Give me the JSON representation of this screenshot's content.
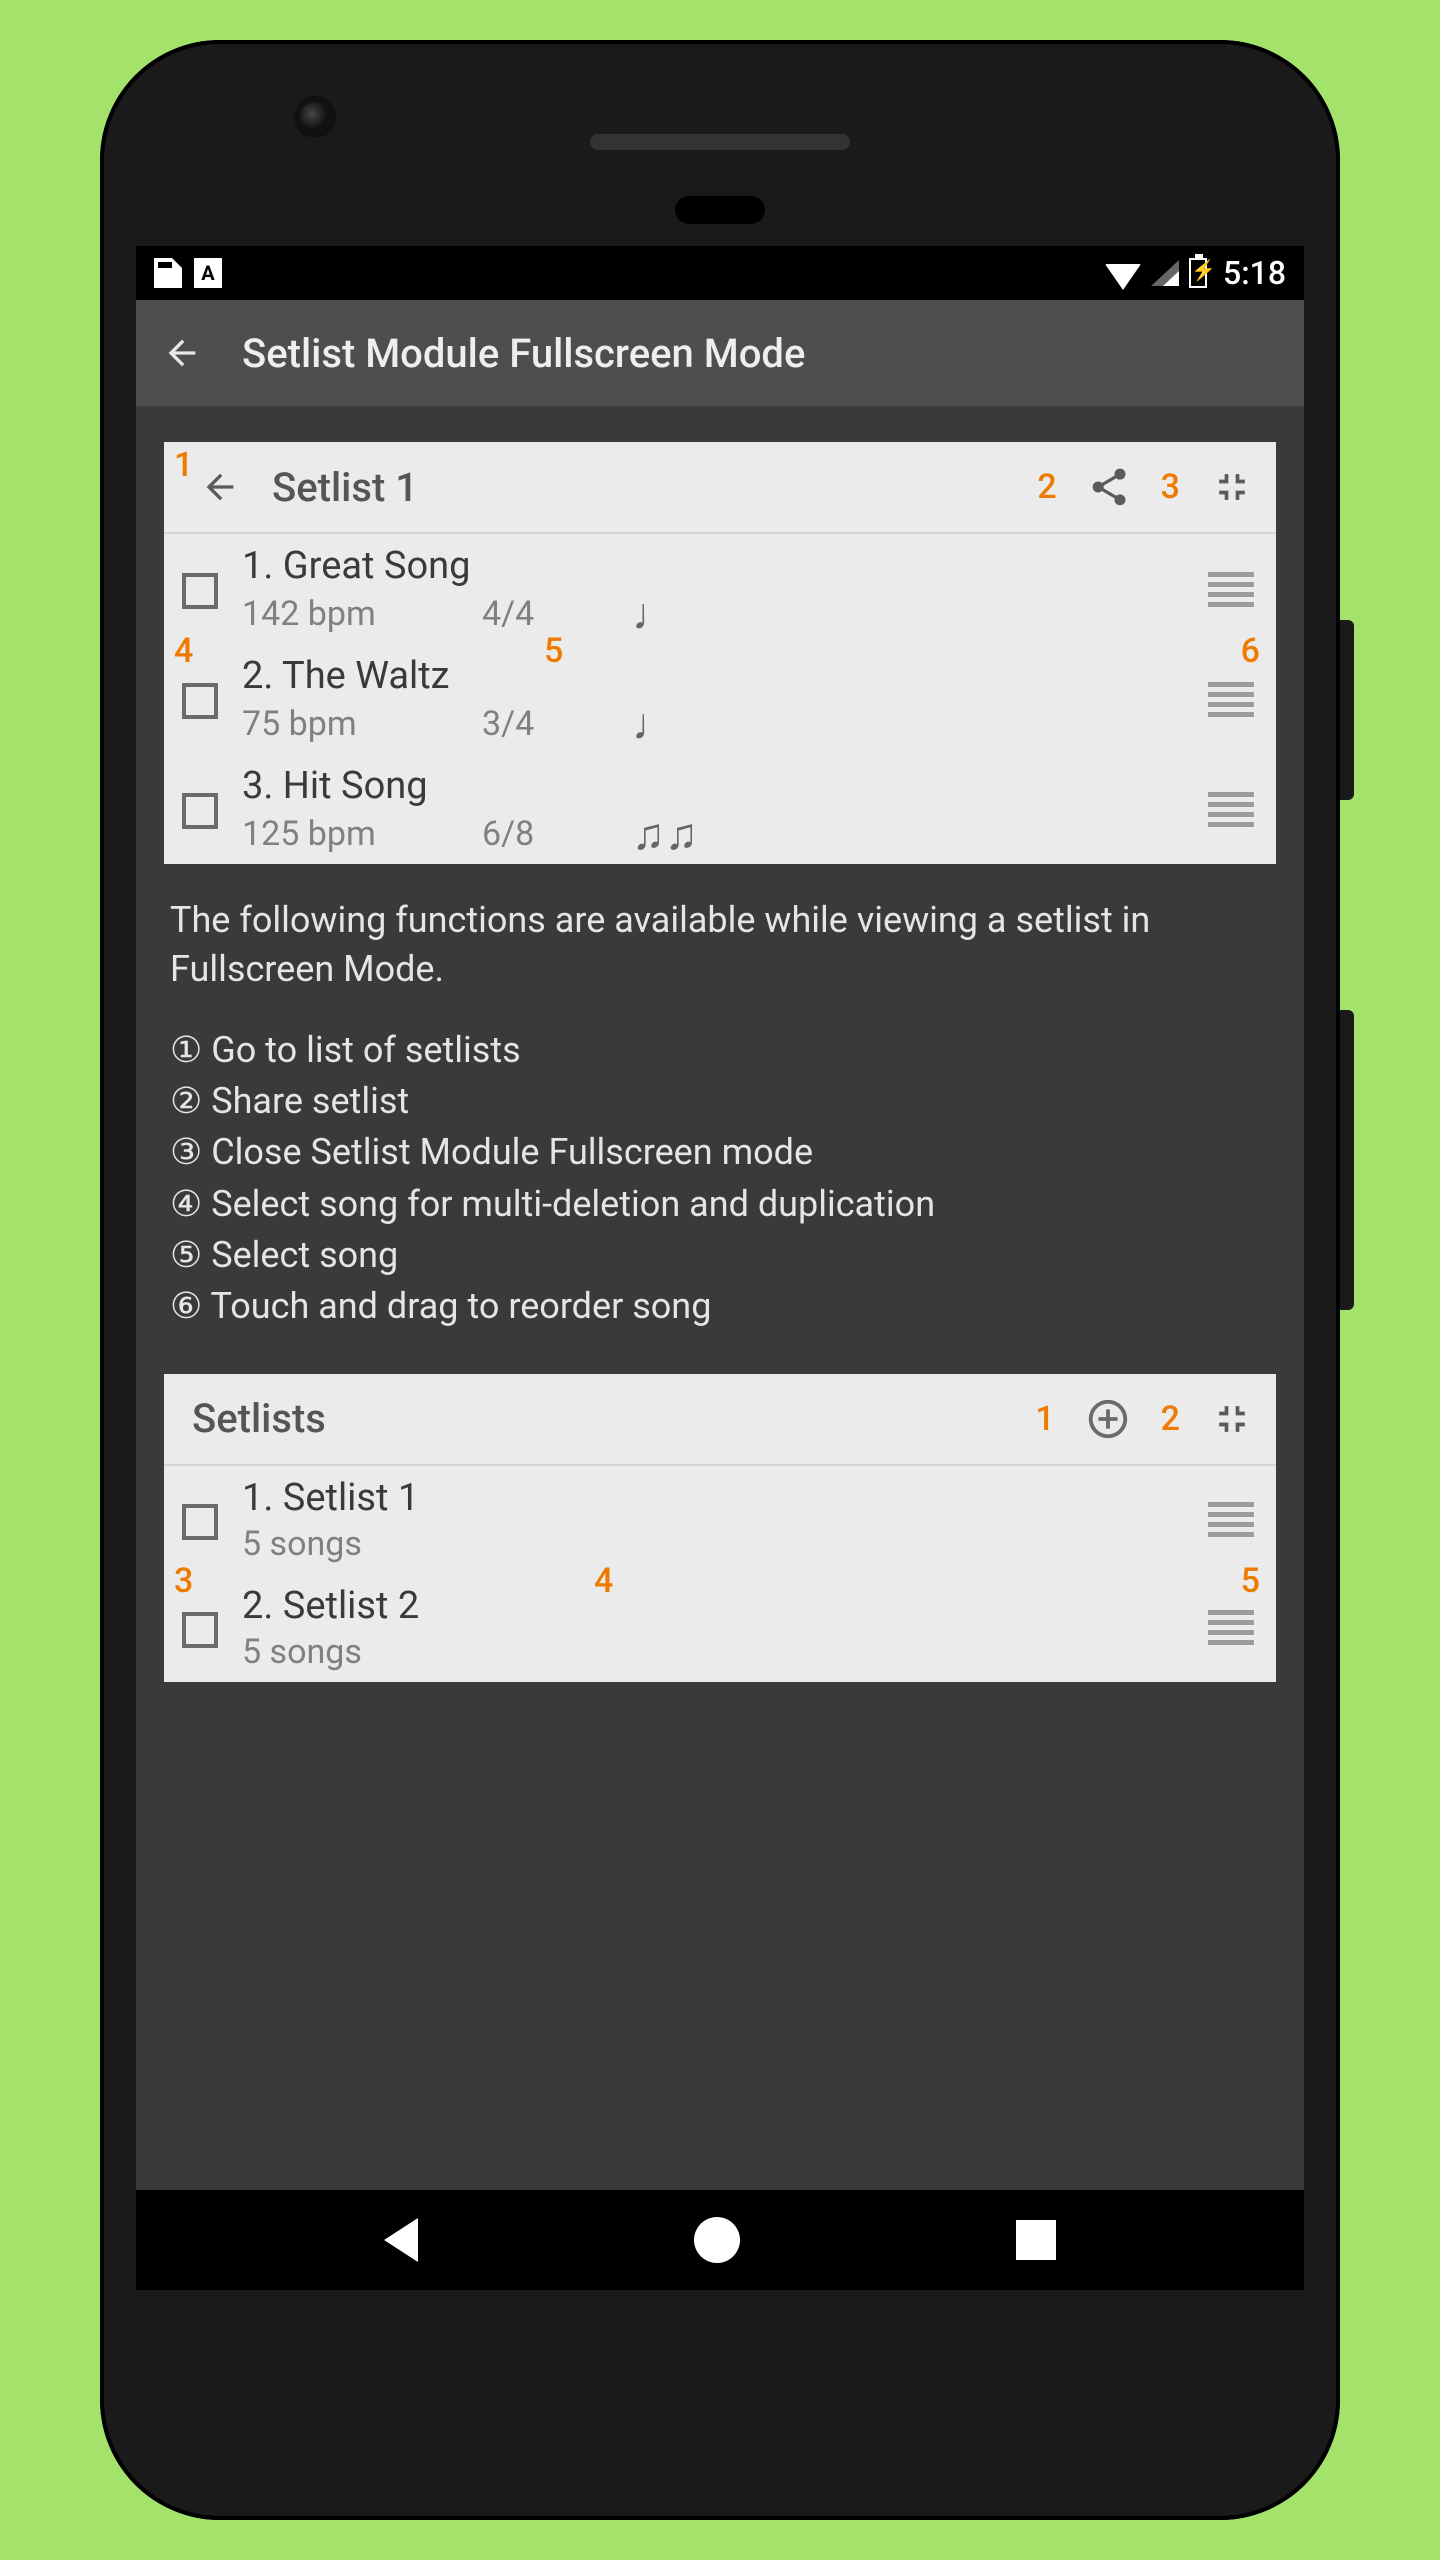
{
  "status": {
    "time": "5:18"
  },
  "appbar": {
    "title": "Setlist Module Fullscreen Mode"
  },
  "card1": {
    "title": "Setlist 1",
    "annot": {
      "a1": "1",
      "a2": "2",
      "a3": "3",
      "a4": "4",
      "a5": "5",
      "a6": "6"
    },
    "songs": [
      {
        "title": "1. Great Song",
        "bpm": "142 bpm",
        "ts": "4/4",
        "note": "♩"
      },
      {
        "title": "2. The Waltz",
        "bpm": "75 bpm",
        "ts": "3/4",
        "note": "♩"
      },
      {
        "title": "3. Hit Song",
        "bpm": "125 bpm",
        "ts": "6/8",
        "note": "♫♫"
      }
    ]
  },
  "description": "The following functions are available while viewing a setlist in Fullscreen Mode.",
  "legend": [
    "① Go to list of setlists",
    "② Share setlist",
    "③ Close Setlist Module Fullscreen mode",
    "④ Select song for multi-deletion and duplication",
    "⑤ Select song",
    "⑥ Touch and drag to reorder song"
  ],
  "card2": {
    "title": "Setlists",
    "annot": {
      "a1": "1",
      "a2": "2",
      "a3": "3",
      "a4": "4",
      "a5": "5"
    },
    "rows": [
      {
        "title": "1. Setlist 1",
        "sub": "5 songs"
      },
      {
        "title": "2. Setlist 2",
        "sub": "5 songs"
      }
    ]
  }
}
